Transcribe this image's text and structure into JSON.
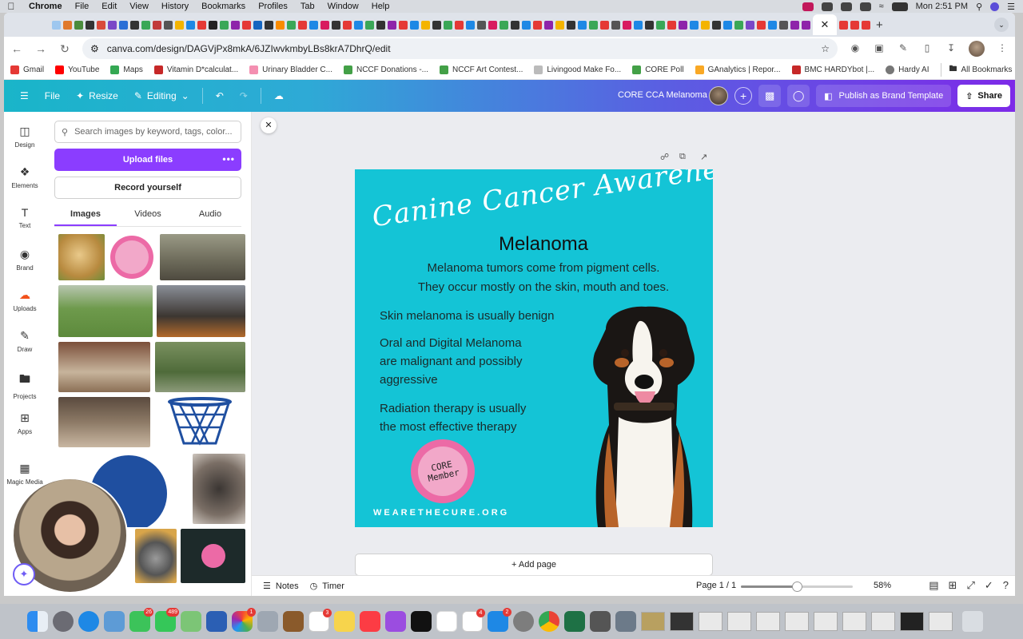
{
  "menubar": {
    "items": [
      "Chrome",
      "File",
      "Edit",
      "View",
      "History",
      "Bookmarks",
      "Profiles",
      "Tab",
      "Window",
      "Help"
    ],
    "clock": "Mon 2:51 PM"
  },
  "browser": {
    "url": "canva.com/design/DAGVjPx8mkA/6JZIwvkmbyLBs8krA7DhrQ/edit",
    "bookmarks": [
      "Gmail",
      "YouTube",
      "Maps",
      "Vitamin D*calculat...",
      "Urinary Bladder C...",
      "NCCF Donations -...",
      "NCCF Art Contest...",
      "Livingood Make Fo...",
      "CORE Poll",
      "GAnalytics | Repor...",
      "BMC HARDYbot |...",
      "Hardy AI"
    ],
    "all_bookmarks": "All Bookmarks"
  },
  "canva_header": {
    "file": "File",
    "resize": "Resize",
    "editing": "Editing",
    "doc_title": "CORE CCA Melanoma",
    "publish": "Publish as Brand Template",
    "share": "Share"
  },
  "rail": [
    {
      "label": "Design",
      "icon": "design-icon"
    },
    {
      "label": "Elements",
      "icon": "elements-icon"
    },
    {
      "label": "Text",
      "icon": "text-icon"
    },
    {
      "label": "Brand",
      "icon": "brand-icon"
    },
    {
      "label": "Uploads",
      "icon": "uploads-icon"
    },
    {
      "label": "Draw",
      "icon": "draw-icon"
    },
    {
      "label": "Projects",
      "icon": "projects-icon"
    },
    {
      "label": "Apps",
      "icon": "apps-icon"
    },
    {
      "label": "Magic Media",
      "icon": "magic-media-icon"
    }
  ],
  "panel": {
    "search_placeholder": "Search images by keyword, tags, color...",
    "upload": "Upload files",
    "record": "Record yourself",
    "tabs": [
      "Images",
      "Videos",
      "Audio"
    ],
    "active_tab": "Images"
  },
  "design": {
    "script_heading": "Canine Cancer Awareness",
    "title": "Melanoma",
    "intro_line1": "Melanoma tumors come from pigment cells.",
    "intro_line2": "They occur mostly on the skin, mouth and toes.",
    "point1": "Skin melanoma is usually benign",
    "point2_line1": "Oral and Digital Melanoma",
    "point2_line2": "are malignant and possibly",
    "point2_line3": "aggressive",
    "point3_line1": "Radiation therapy is usually",
    "point3_line2": "the most effective therapy",
    "badge_line1": "CORE",
    "badge_line2": "Member",
    "url": "WEARETHECURE.ORG",
    "bg_color": "#14c4d6"
  },
  "canvas": {
    "add_page": "+ Add page"
  },
  "footer": {
    "notes": "Notes",
    "timer": "Timer",
    "page": "Page 1 / 1",
    "zoom": "58%",
    "zoom_level": 0.5
  },
  "dock": {
    "badges": [
      "26",
      "489",
      "1",
      "3",
      "4",
      "2"
    ]
  }
}
